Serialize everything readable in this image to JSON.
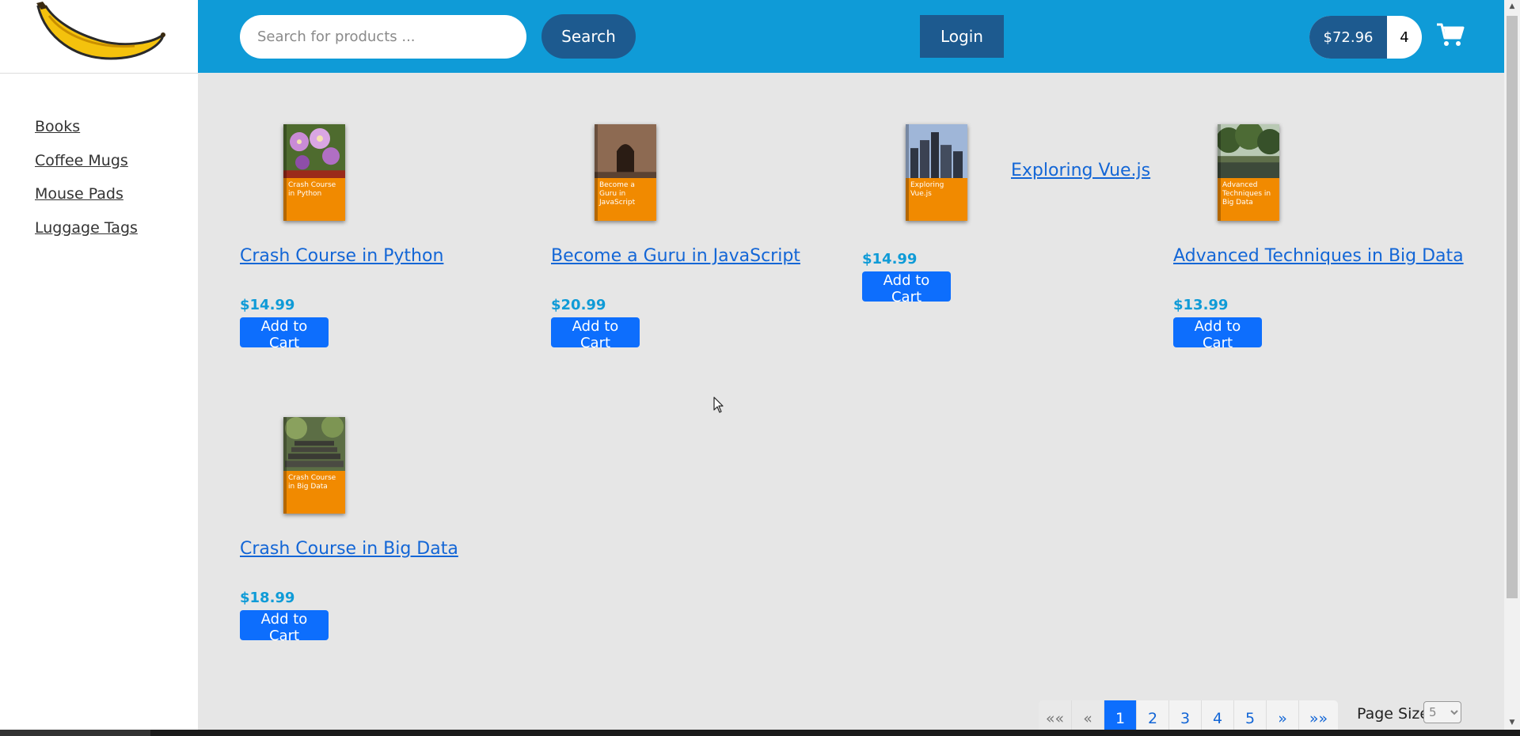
{
  "header": {
    "search": {
      "placeholder": "Search for products ...",
      "button_label": "Search"
    },
    "login_label": "Login",
    "cart": {
      "total": "$72.96",
      "count": "4",
      "icon": "shopping-cart-icon"
    },
    "logo_icon": "banana-logo"
  },
  "colors": {
    "header_bg": "#0f9bd7",
    "dark_button": "#1d5a8f",
    "primary": "#0d6efd",
    "price": "#0f9bd7",
    "link": "#1366d6"
  },
  "sidebar": {
    "items": [
      {
        "label": "Books"
      },
      {
        "label": "Coffee Mugs"
      },
      {
        "label": "Mouse Pads"
      },
      {
        "label": "Luggage Tags"
      }
    ]
  },
  "products": [
    {
      "title": "Crash Course in Python",
      "price": "$14.99",
      "cover_title": "Crash Course in Python",
      "button": "Add to Cart"
    },
    {
      "title": "Become a Guru in JavaScript",
      "price": "$20.99",
      "cover_title": "Become a Guru in JavaScript",
      "button": "Add to Cart"
    },
    {
      "title": "Exploring Vue.js",
      "price": "$14.99",
      "cover_title": "Exploring Vue.js",
      "button": "Add to Cart"
    },
    {
      "title": "Advanced Techniques in Big Data",
      "price": "$13.99",
      "cover_title": "Advanced Techniques in Big Data",
      "button": "Add to Cart"
    },
    {
      "title": "Crash Course in Big Data",
      "price": "$18.99",
      "cover_title": "Crash Course in Big Data",
      "button": "Add to Cart"
    }
  ],
  "pagination": {
    "first": "««",
    "prev": "«",
    "pages": [
      "1",
      "2",
      "3",
      "4",
      "5"
    ],
    "current": "1",
    "next": "»",
    "last": "»»",
    "page_size_label": "Page Size",
    "page_size_value": "5"
  }
}
